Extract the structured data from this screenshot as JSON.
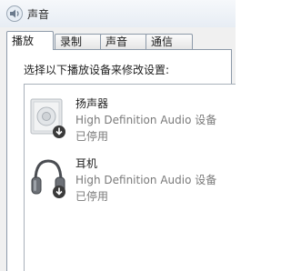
{
  "window": {
    "title": "声音",
    "title_icon": "speaker-icon"
  },
  "tabs": [
    {
      "label": "播放",
      "active": true
    },
    {
      "label": "录制",
      "active": false
    },
    {
      "label": "声音",
      "active": false
    },
    {
      "label": "通信",
      "active": false
    }
  ],
  "instructions": "选择以下播放设备来修改设置:",
  "devices": [
    {
      "name": "扬声器",
      "description": "High Definition Audio 设备",
      "status": "已停用",
      "icon": "speaker-device-icon"
    },
    {
      "name": "耳机",
      "description": "High Definition Audio 设备",
      "status": "已停用",
      "icon": "headphones-device-icon"
    }
  ],
  "colors": {
    "disabled_text": "#7a7a7a",
    "tab_border": "#8d9aa9"
  }
}
